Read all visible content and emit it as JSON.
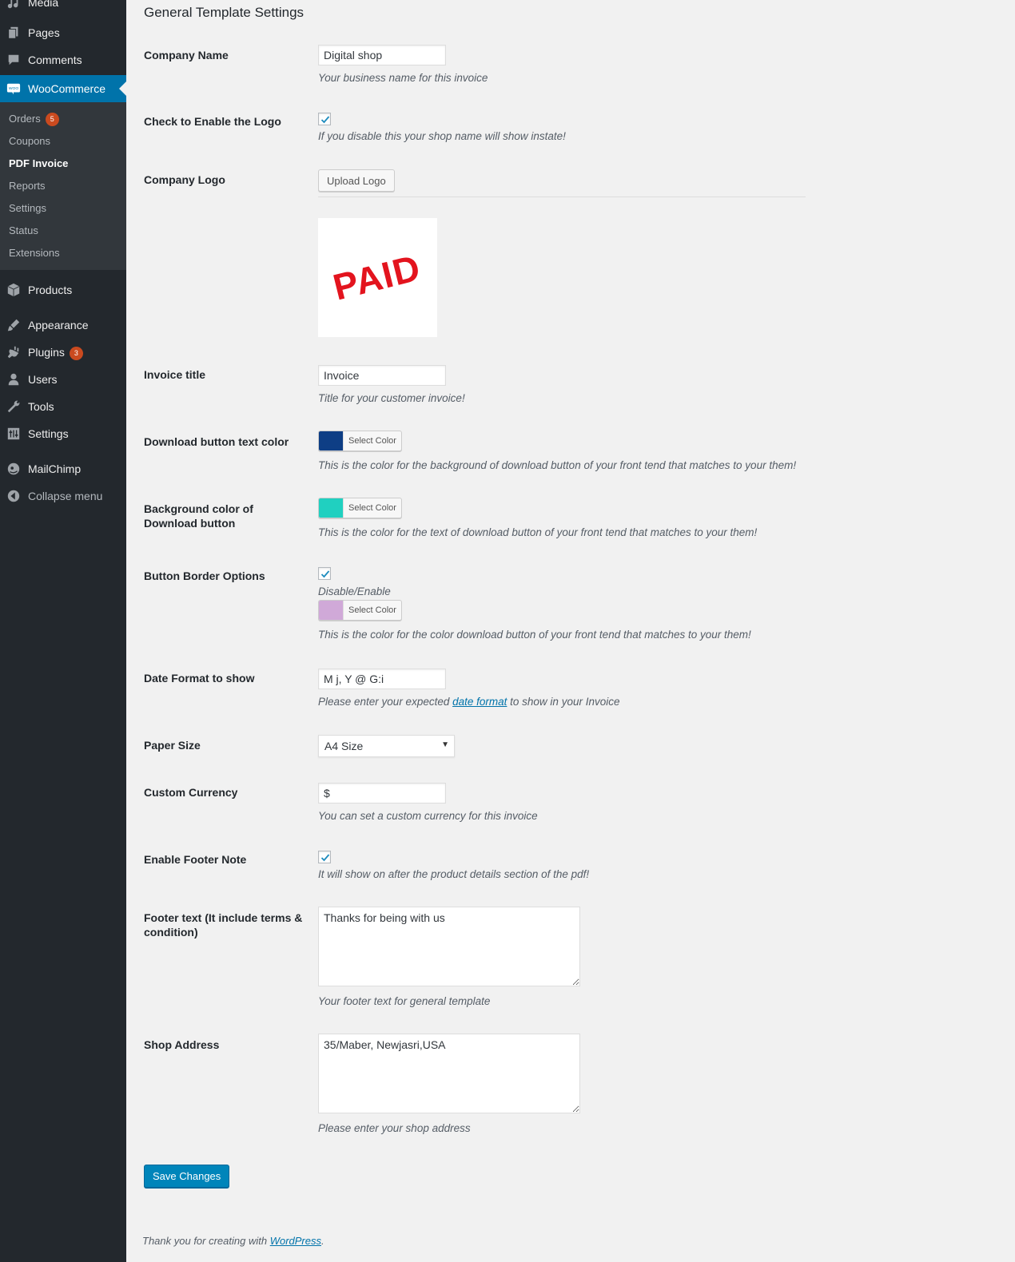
{
  "sidebar": {
    "top_items": [
      {
        "label": "Media",
        "icon": "media-icon"
      },
      {
        "label": "Pages",
        "icon": "pages-icon"
      },
      {
        "label": "Comments",
        "icon": "comments-icon"
      }
    ],
    "woocommerce": {
      "label": "WooCommerce",
      "icon": "woo-icon",
      "icon_text": "WOO"
    },
    "submenu": [
      {
        "label": "Orders",
        "badge": "5"
      },
      {
        "label": "Coupons"
      },
      {
        "label": "PDF Invoice",
        "active": true
      },
      {
        "label": "Reports"
      },
      {
        "label": "Settings"
      },
      {
        "label": "Status"
      },
      {
        "label": "Extensions"
      }
    ],
    "items": [
      {
        "label": "Products",
        "icon": "products-icon"
      },
      {
        "label": "Appearance",
        "icon": "appearance-icon"
      },
      {
        "label": "Plugins",
        "icon": "plugins-icon",
        "badge": "3"
      },
      {
        "label": "Users",
        "icon": "users-icon"
      },
      {
        "label": "Tools",
        "icon": "tools-icon"
      },
      {
        "label": "Settings",
        "icon": "settings-icon"
      },
      {
        "label": "MailChimp",
        "icon": "mailchimp-icon"
      },
      {
        "label": "Collapse menu",
        "icon": "collapse-icon"
      }
    ]
  },
  "main": {
    "section_title": "General Template Settings",
    "company_name": {
      "label": "Company Name",
      "value": "Digital shop",
      "desc": "Your business name for this invoice"
    },
    "enable_logo": {
      "label": "Check to Enable the Logo",
      "checked": true,
      "desc": "If you disable this your shop name will show instate!"
    },
    "company_logo": {
      "label": "Company Logo",
      "button": "Upload Logo",
      "logo_text": "PAID"
    },
    "invoice_title": {
      "label": "Invoice title",
      "value": "Invoice",
      "desc": "Title for your customer invoice!"
    },
    "download_text_color": {
      "label": "Download button text color",
      "color": "#0e3e85",
      "button": "Select Color",
      "desc": "This is the color for the background of download button of your front tend that matches to your them!"
    },
    "download_bg_color": {
      "label": "Background color of Download button",
      "color": "#20d0c0",
      "button": "Select Color",
      "desc": "This is the color for the text of download button of your front tend that matches to your them!"
    },
    "button_border": {
      "label": "Button Border Options",
      "checked": true,
      "toggle_label": "Disable/Enable",
      "color": "#d0a9d8",
      "button": "Select Color",
      "desc": "This is the color for the color download button of your front tend that matches to your them!"
    },
    "date_format": {
      "label": "Date Format to show",
      "value": "M j, Y @ G:i",
      "desc_pre": "Please enter your expected ",
      "desc_link": "date format",
      "desc_post": " to show in your Invoice"
    },
    "paper_size": {
      "label": "Paper Size",
      "value": "A4 Size"
    },
    "custom_currency": {
      "label": "Custom Currency",
      "value": "$",
      "desc": "You can set a custom currency for this invoice"
    },
    "footer_note": {
      "label": "Enable Footer Note",
      "checked": true,
      "desc": "It will show on after the product details section of the pdf!"
    },
    "footer_text": {
      "label": "Footer text (It include terms & condition)",
      "value": "Thanks for being with us",
      "desc": "Your footer text for general template"
    },
    "shop_address": {
      "label": "Shop Address",
      "value": "35/Maber, Newjasri,USA",
      "desc": "Please enter your shop address"
    },
    "save_button": "Save Changes",
    "footer_pre": "Thank you for creating with ",
    "footer_link": "WordPress",
    "footer_post": "."
  },
  "colors": {
    "sidebar_bg": "#23282d",
    "submenu_bg": "#32373c",
    "accent": "#0073aa",
    "primary_button": "#0085ba",
    "badge": "#ca4a1f",
    "logo_red": "#e3141e"
  }
}
